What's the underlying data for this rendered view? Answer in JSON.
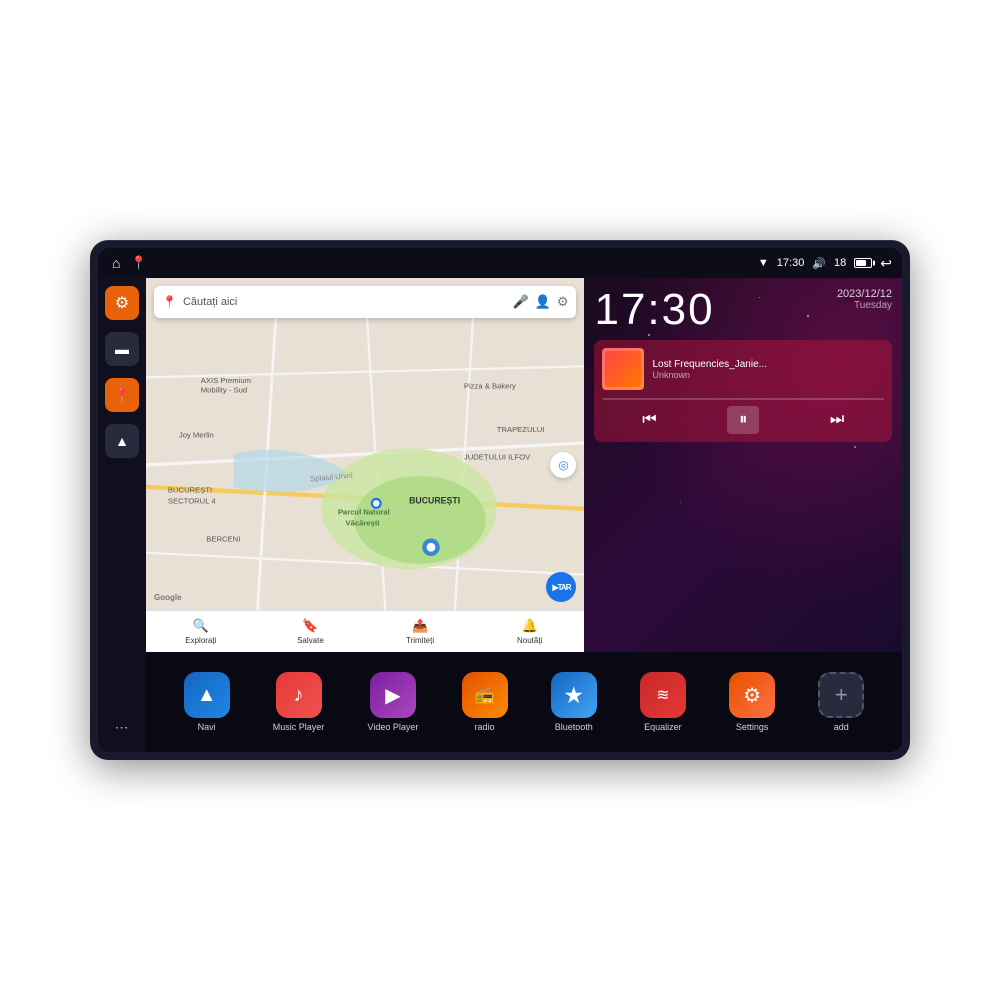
{
  "device": {
    "status_bar": {
      "wifi_icon": "▼",
      "time": "17:30",
      "volume_icon": "🔊",
      "battery_level": "18",
      "back_icon": "↩"
    },
    "sidebar": {
      "items": [
        {
          "label": "Settings",
          "icon": "⚙",
          "color": "orange"
        },
        {
          "label": "Files",
          "icon": "▬",
          "color": "dark"
        },
        {
          "label": "Maps",
          "icon": "📍",
          "color": "orange"
        },
        {
          "label": "Navigation",
          "icon": "▲",
          "color": "dark"
        },
        {
          "label": "Apps",
          "icon": "⋮⋮⋮",
          "color": "apps"
        }
      ]
    },
    "map": {
      "search_placeholder": "Căutați aici",
      "locations": [
        "AXIS Premium Mobility - Sud",
        "Pizza & Bakery",
        "Parcul Natural Văcărești",
        "BUCUREȘTI",
        "JUDEȚUL ILFOV",
        "BUCUREȘTI SECTORUL 4",
        "BERCENI",
        "TRAPEZULUI"
      ],
      "nav_items": [
        {
          "label": "Explorați",
          "icon": "🔍"
        },
        {
          "label": "Salvate",
          "icon": "🔖"
        },
        {
          "label": "Trimiteți",
          "icon": "📤"
        },
        {
          "label": "Noutăți",
          "icon": "🔔"
        }
      ]
    },
    "clock": {
      "time": "17:30",
      "date": "2023/12/12",
      "day": "Tuesday"
    },
    "music": {
      "title": "Lost Frequencies_Janie...",
      "artist": "Unknown",
      "controls": {
        "prev": "⏮",
        "play": "⏸",
        "next": "⏭"
      }
    },
    "apps": [
      {
        "label": "Navi",
        "class": "app-navi",
        "icon": "▲"
      },
      {
        "label": "Music Player",
        "class": "app-music",
        "icon": "♪"
      },
      {
        "label": "Video Player",
        "class": "app-video",
        "icon": "▶"
      },
      {
        "label": "radio",
        "class": "app-radio",
        "icon": "📻"
      },
      {
        "label": "Bluetooth",
        "class": "app-bt",
        "icon": "⚡"
      },
      {
        "label": "Equalizer",
        "class": "app-eq",
        "icon": "≋"
      },
      {
        "label": "Settings",
        "class": "app-settings",
        "icon": "⚙"
      },
      {
        "label": "add",
        "class": "app-add",
        "icon": "+"
      }
    ]
  }
}
